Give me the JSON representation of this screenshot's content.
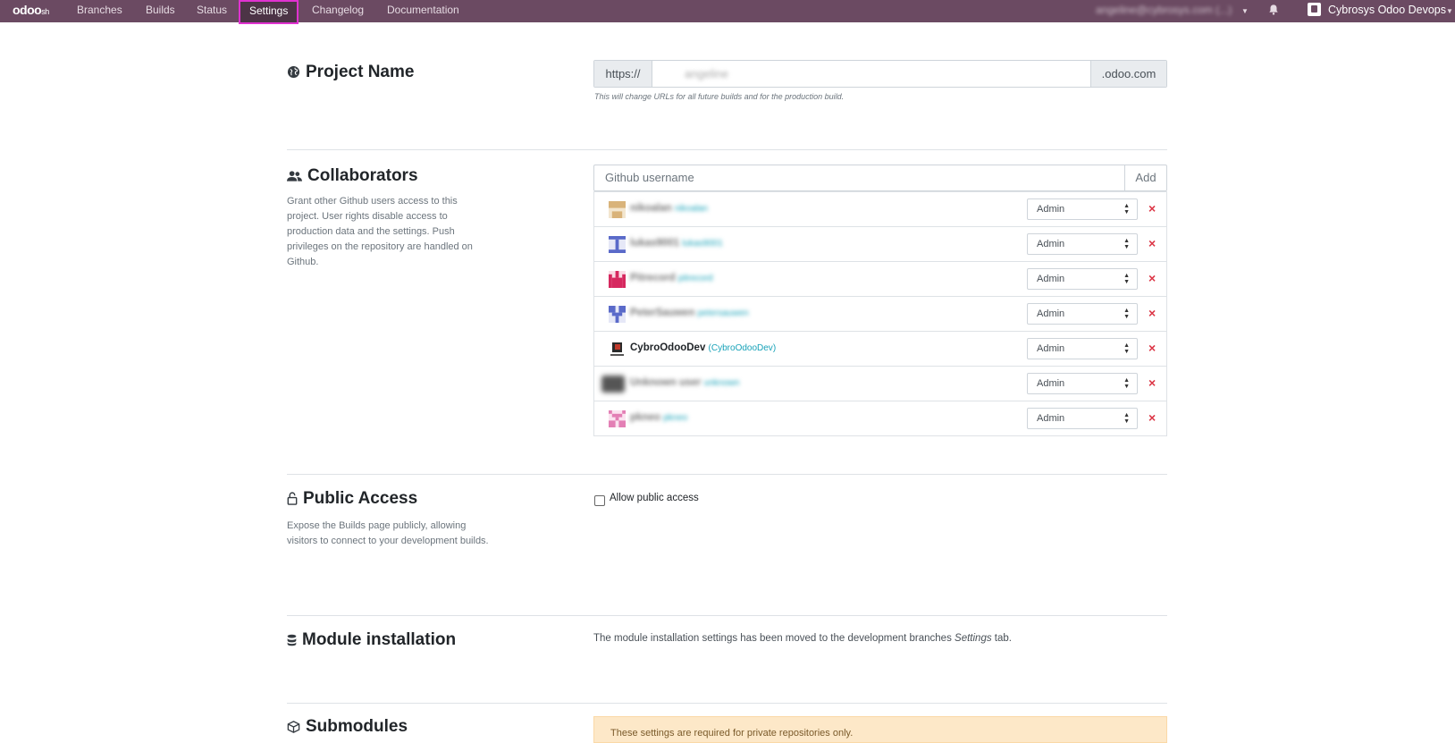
{
  "navbar": {
    "brand_main": "odoo",
    "brand_suffix": "sh",
    "links": [
      "Branches",
      "Builds",
      "Status",
      "Settings",
      "Changelog",
      "Documentation"
    ],
    "active_link": "Settings",
    "user_email": "angeline@cybrosys.com (...)",
    "company": "Cybrosys Odoo Devops"
  },
  "project_name": {
    "title": "Project Name",
    "url_prefix": "https://",
    "url_value": "angeline",
    "url_suffix": ".odoo.com",
    "help": "This will change URLs for all future builds and for the production build."
  },
  "collaborators": {
    "title": "Collaborators",
    "description": "Grant other Github users access to this project. User rights disable access to production data and the settings. Push privileges on the repository are handled on Github.",
    "input_placeholder": "Github username",
    "add_label": "Add",
    "rows": [
      {
        "name": "nikoalan",
        "login": "nikoalan",
        "role": "Admin",
        "blurred": true,
        "avatar_color": "#d9b37a"
      },
      {
        "name": "lukas9001",
        "login": "lukas9001",
        "role": "Admin",
        "blurred": true,
        "avatar_color": "#5a6ac9"
      },
      {
        "name": "Pitrecord",
        "login": "pitrecord",
        "role": "Admin",
        "blurred": true,
        "avatar_color": "#d6285f"
      },
      {
        "name": "PeterSauwen",
        "login": "petersauwen",
        "role": "Admin",
        "blurred": true,
        "avatar_color": "#5a6ac9"
      },
      {
        "name": "CybroOdooDev",
        "login": "CybroOdooDev",
        "role": "Admin",
        "blurred": false,
        "avatar_color": "#8a2b20"
      },
      {
        "name": "Unknown user",
        "login": "unknown",
        "role": "Admin",
        "blurred": true,
        "avatar_color": "#555555"
      },
      {
        "name": "pkneo",
        "login": "pkneo",
        "role": "Admin",
        "blurred": true,
        "avatar_color": "#e37fb5"
      }
    ],
    "remove_symbol": "×"
  },
  "public_access": {
    "title": "Public Access",
    "description": "Expose the Builds page publicly, allowing visitors to connect to your development builds.",
    "checkbox_label": "Allow public access",
    "checked": false
  },
  "module_installation": {
    "title": "Module installation",
    "text_before": "The module installation settings has been moved to the development branches ",
    "text_em": "Settings",
    "text_after": " tab."
  },
  "submodules": {
    "title": "Submodules",
    "alert": "These settings are required for private repositories only."
  }
}
